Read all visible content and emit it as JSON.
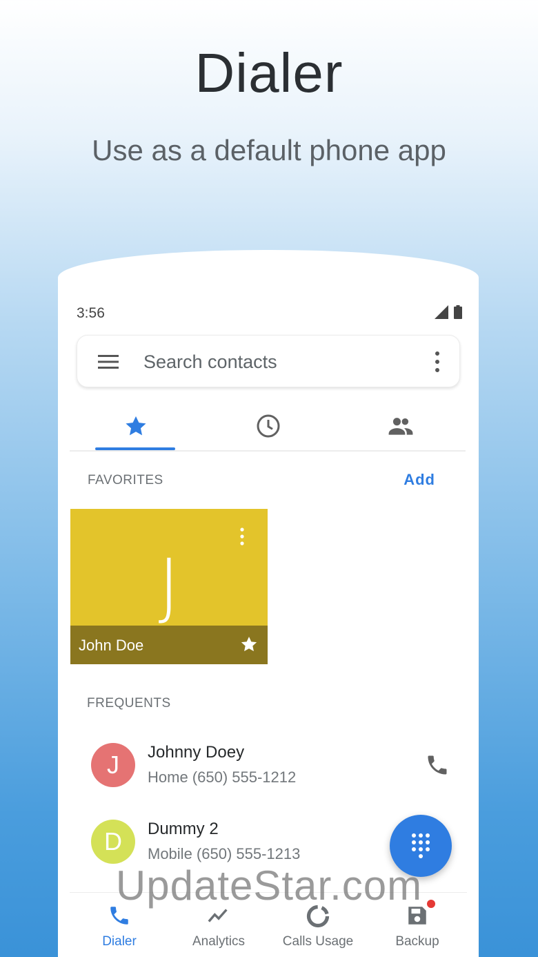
{
  "promo": {
    "title": "Dialer",
    "subtitle": "Use as a default phone app"
  },
  "status_bar": {
    "time": "3:56",
    "icons": [
      "signal-icon",
      "battery-icon"
    ]
  },
  "search": {
    "placeholder": "Search contacts",
    "menu_icon": "hamburger-icon",
    "more_icon": "more-vertical-icon"
  },
  "tabs": [
    {
      "icon": "star-icon",
      "selected": true
    },
    {
      "icon": "clock-icon",
      "selected": false
    },
    {
      "icon": "contacts-icon",
      "selected": false
    }
  ],
  "favorites": {
    "label": "FAVORITES",
    "add_label": "Add",
    "items": [
      {
        "initial": "J",
        "name": "John Doe",
        "color": "#e3c42b"
      }
    ]
  },
  "frequents": {
    "label": "FREQUENTS",
    "items": [
      {
        "initial": "J",
        "name": "Johnny Doey",
        "detail": "Home (650) 555-1212",
        "color": "#e57373"
      },
      {
        "initial": "D",
        "name": "Dummy 2",
        "detail": "Mobile (650) 555-1213",
        "color": "#d4e157"
      }
    ]
  },
  "fab": {
    "icon": "dialpad-icon"
  },
  "watermark": "UpdateStar.com",
  "bottom_nav": [
    {
      "label": "Dialer",
      "icon": "phone-icon",
      "active": true
    },
    {
      "label": "Analytics",
      "icon": "analytics-icon",
      "active": false
    },
    {
      "label": "Calls Usage",
      "icon": "donut-icon",
      "active": false
    },
    {
      "label": "Backup",
      "icon": "save-icon",
      "active": false,
      "badge": true
    }
  ],
  "colors": {
    "accent": "#2f7de1",
    "favorite_footer": "#8a761f",
    "badge": "#e53935"
  }
}
